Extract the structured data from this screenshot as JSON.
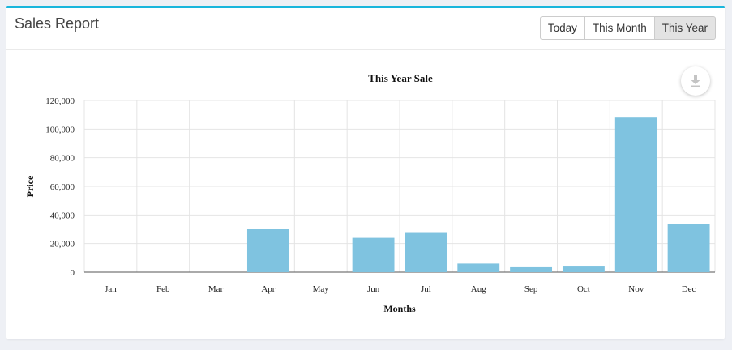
{
  "header": {
    "title": "Sales Report",
    "buttons": [
      "Today",
      "This Month",
      "This Year"
    ],
    "active_index": 2
  },
  "colors": {
    "accent": "#1ab6dc",
    "bar": "#7fc3e0"
  },
  "download_icon": "download-icon",
  "chart_data": {
    "type": "bar",
    "title": "This Year Sale",
    "xlabel": "Months",
    "ylabel": "Price",
    "categories": [
      "Jan",
      "Feb",
      "Mar",
      "Apr",
      "May",
      "Jun",
      "Jul",
      "Aug",
      "Sep",
      "Oct",
      "Nov",
      "Dec"
    ],
    "values": [
      0,
      0,
      0,
      30000,
      0,
      24000,
      28000,
      6000,
      4000,
      4500,
      108000,
      33500
    ],
    "ylim": [
      0,
      120000
    ],
    "yticks": [
      "0",
      "20,000",
      "40,000",
      "60,000",
      "80,000",
      "100,000",
      "120,000"
    ],
    "grid": true
  }
}
